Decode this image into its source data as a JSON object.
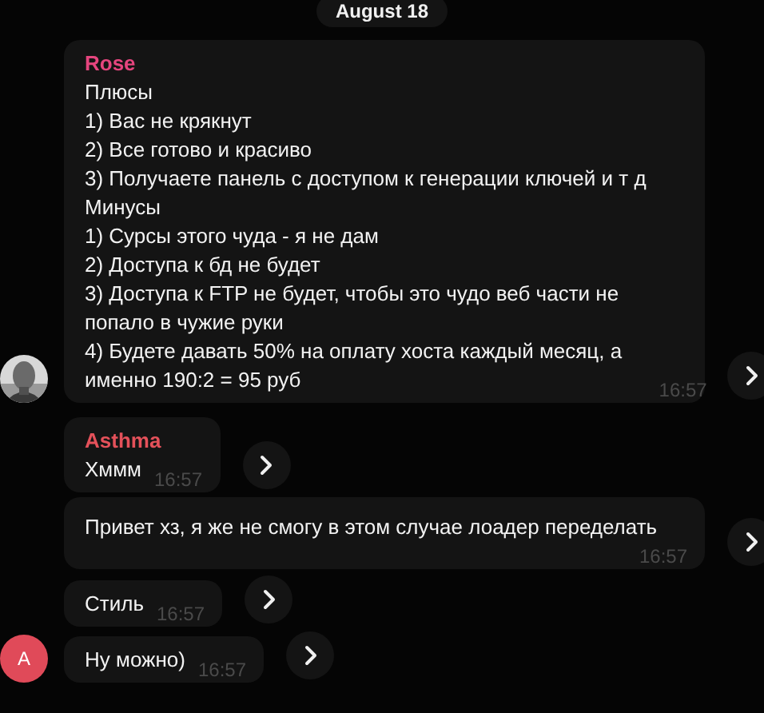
{
  "date_badge": "August 18",
  "messages": [
    {
      "sender": "Rose",
      "color": "#e5457e",
      "text": "Плюсы\n1) Вас не крякнут\n2) Все готово и красиво\n3) Получаете панель с доступом к генерации ключей и т д\nМинусы\n1) Сурсы этого чуда - я не дам\n2) Доступа к бд не будет\n3) Доступа к FTP не будет, чтобы это чудо веб части не\nпопало в чужие руки\n4) Будете давать 50% на оплату хоста каждый месяц, а\nименно 190:2 = 95 руб",
      "time": "16:57"
    },
    {
      "sender": "Asthma",
      "color": "#e4515a",
      "text": "Хммм",
      "time": "16:57"
    },
    {
      "text": "Привет хз, я же не смогу в этом случае лоадер переделать",
      "time": "16:57"
    },
    {
      "text": "Стиль",
      "time": "16:57"
    },
    {
      "text": "Ну можно)",
      "time": "16:57",
      "avatar": {
        "kind": "letter",
        "letter": "A",
        "color": "#e04a59"
      }
    }
  ]
}
